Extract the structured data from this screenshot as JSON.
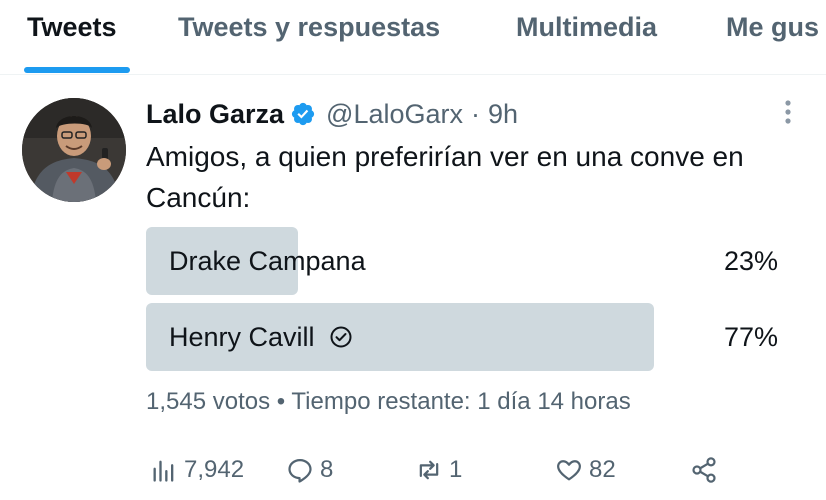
{
  "tabs": [
    {
      "label": "Tweets",
      "active": true
    },
    {
      "label": "Tweets y respuestas",
      "active": false
    },
    {
      "label": "Multimedia",
      "active": false
    },
    {
      "label": "Me gus",
      "active": false
    }
  ],
  "tweet": {
    "author_name": "Lalo Garza",
    "verified_icon": "verified-badge-icon",
    "handle": "@LaloGarx",
    "separator": "·",
    "time": "9h",
    "text": "Amigos, a quien preferirían ver en una conve en Cancún:"
  },
  "poll": {
    "options": [
      {
        "label": "Drake Campana",
        "percent_text": "23%",
        "percent": 23,
        "winner": false
      },
      {
        "label": "Henry Cavill",
        "percent_text": "77%",
        "percent": 77,
        "winner": true
      }
    ],
    "votes": "1,545 votos",
    "separator": "•",
    "remaining": "Tiempo restante: 1 día 14 horas"
  },
  "actions": {
    "views": "7,942",
    "replies": "8",
    "retweets": "1",
    "likes": "82"
  },
  "colors": {
    "accent": "#1d9bf0",
    "muted_text": "#536471",
    "poll_bar": "#cfd9de"
  }
}
